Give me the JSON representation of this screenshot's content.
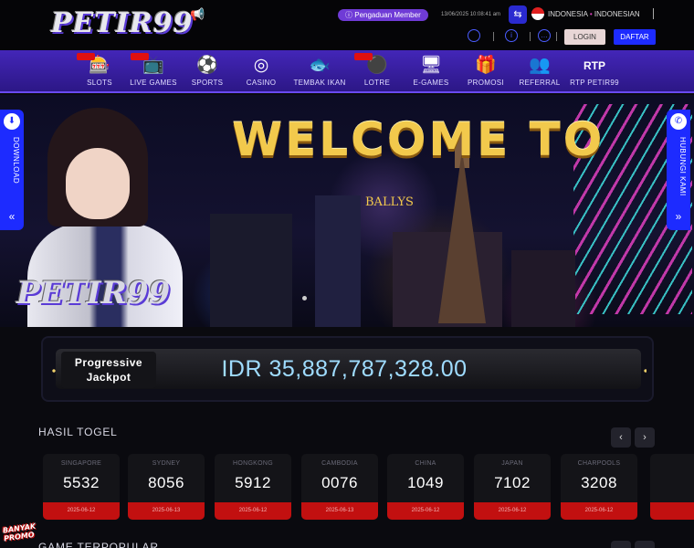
{
  "header": {
    "logo_text": "PETIR99",
    "complaint_label": "Pengaduan Member",
    "datetime": "13/06/2025 10:08:41 am",
    "language": "INDONESIA",
    "language_alt": "INDONESIAN",
    "login_label": "LOGIN",
    "register_label": "DAFTAR"
  },
  "nav": {
    "items": [
      {
        "label": "SLOTS",
        "icon": "slot-machine-icon",
        "glyph": "🎰"
      },
      {
        "label": "LIVE GAMES",
        "icon": "live-tv-icon",
        "glyph": "📺"
      },
      {
        "label": "SPORTS",
        "icon": "soccer-player-icon",
        "glyph": "⚽"
      },
      {
        "label": "CASINO",
        "icon": "roulette-icon",
        "glyph": "◎"
      },
      {
        "label": "TEMBAK IKAN",
        "icon": "fish-icon",
        "glyph": "🐟"
      },
      {
        "label": "LOTRE",
        "icon": "lottery-balls-icon",
        "glyph": "⚫"
      },
      {
        "label": "E-GAMES",
        "icon": "monitor-icon",
        "glyph": "🖥"
      },
      {
        "label": "PROMOSI",
        "icon": "gift-icon",
        "glyph": "🎁"
      },
      {
        "label": "REFERRAL",
        "icon": "people-icon",
        "glyph": "👥"
      },
      {
        "label": "RTP PETIR99",
        "icon": "rtp-icon",
        "glyph": "RTP"
      }
    ]
  },
  "banner": {
    "headline": "WELCOME TO",
    "logo_text": "PETIR99",
    "sign_text": "BALLYS",
    "download_label": "DOWNLOAD",
    "contact_label": "HUBUNGI KAMI"
  },
  "jackpot": {
    "label_line1": "Progressive",
    "label_line2": "Jackpot",
    "amount": "IDR 35,887,787,328.00"
  },
  "togel": {
    "title": "HASIL TOGEL",
    "results": [
      {
        "market": "SINGAPORE",
        "number": "5532",
        "date": "2025-06-12"
      },
      {
        "market": "SYDNEY",
        "number": "8056",
        "date": "2025-06-13"
      },
      {
        "market": "HONGKONG",
        "number": "5912",
        "date": "2025-06-12"
      },
      {
        "market": "CAMBODIA",
        "number": "0076",
        "date": "2025-06-13"
      },
      {
        "market": "CHINA",
        "number": "1049",
        "date": "2025-06-12"
      },
      {
        "market": "JAPAN",
        "number": "7102",
        "date": "2025-06-12"
      },
      {
        "market": "CHARPOOLS",
        "number": "3208",
        "date": "2025-06-12"
      }
    ]
  },
  "promo_badge": {
    "line1": "BANYAK",
    "line2": "PROMO"
  },
  "popular": {
    "title": "GAME TERPOPULAR"
  }
}
